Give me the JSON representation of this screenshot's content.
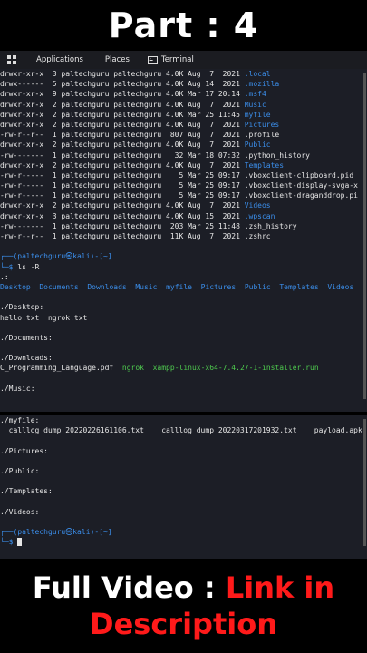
{
  "header": {
    "title": "Part : 4"
  },
  "panel": {
    "applications": "Applications",
    "places": "Places",
    "terminal": "Terminal"
  },
  "listing": [
    {
      "perm": "drwxr-xr-x",
      "links": "3",
      "user": "paltechguru",
      "group": "paltechguru",
      "size": "4.0K",
      "month": "Aug",
      "day": "7",
      "time": "2021",
      "name": ".local",
      "color": "blue"
    },
    {
      "perm": "drwx------",
      "links": "5",
      "user": "paltechguru",
      "group": "paltechguru",
      "size": "4.0K",
      "month": "Aug",
      "day": "14",
      "time": "2021",
      "name": ".mozilla",
      "color": "blue"
    },
    {
      "perm": "drwxr-xr-x",
      "links": "9",
      "user": "paltechguru",
      "group": "paltechguru",
      "size": "4.0K",
      "month": "Mar",
      "day": "17",
      "time": "20:14",
      "name": ".msf4",
      "color": "blue"
    },
    {
      "perm": "drwxr-xr-x",
      "links": "2",
      "user": "paltechguru",
      "group": "paltechguru",
      "size": "4.0K",
      "month": "Aug",
      "day": "7",
      "time": "2021",
      "name": "Music",
      "color": "blue"
    },
    {
      "perm": "drwxr-xr-x",
      "links": "2",
      "user": "paltechguru",
      "group": "paltechguru",
      "size": "4.0K",
      "month": "Mar",
      "day": "25",
      "time": "11:45",
      "name": "myfile",
      "color": "blue"
    },
    {
      "perm": "drwxr-xr-x",
      "links": "2",
      "user": "paltechguru",
      "group": "paltechguru",
      "size": "4.0K",
      "month": "Aug",
      "day": "7",
      "time": "2021",
      "name": "Pictures",
      "color": "blue"
    },
    {
      "perm": "-rw-r--r--",
      "links": "1",
      "user": "paltechguru",
      "group": "paltechguru",
      "size": "807",
      "month": "Aug",
      "day": "7",
      "time": "2021",
      "name": ".profile",
      "color": "white"
    },
    {
      "perm": "drwxr-xr-x",
      "links": "2",
      "user": "paltechguru",
      "group": "paltechguru",
      "size": "4.0K",
      "month": "Aug",
      "day": "7",
      "time": "2021",
      "name": "Public",
      "color": "blue"
    },
    {
      "perm": "-rw-------",
      "links": "1",
      "user": "paltechguru",
      "group": "paltechguru",
      "size": "32",
      "month": "Mar",
      "day": "18",
      "time": "07:32",
      "name": ".python_history",
      "color": "white"
    },
    {
      "perm": "drwxr-xr-x",
      "links": "2",
      "user": "paltechguru",
      "group": "paltechguru",
      "size": "4.0K",
      "month": "Aug",
      "day": "7",
      "time": "2021",
      "name": "Templates",
      "color": "blue"
    },
    {
      "perm": "-rw-r-----",
      "links": "1",
      "user": "paltechguru",
      "group": "paltechguru",
      "size": "5",
      "month": "Mar",
      "day": "25",
      "time": "09:17",
      "name": ".vboxclient-clipboard.pid",
      "color": "white"
    },
    {
      "perm": "-rw-r-----",
      "links": "1",
      "user": "paltechguru",
      "group": "paltechguru",
      "size": "5",
      "month": "Mar",
      "day": "25",
      "time": "09:17",
      "name": ".vboxclient-display-svga-x",
      "color": "white"
    },
    {
      "perm": "-rw-r-----",
      "links": "1",
      "user": "paltechguru",
      "group": "paltechguru",
      "size": "5",
      "month": "Mar",
      "day": "25",
      "time": "09:17",
      "name": ".vboxclient-draganddrop.pi",
      "color": "white"
    },
    {
      "perm": "drwxr-xr-x",
      "links": "2",
      "user": "paltechguru",
      "group": "paltechguru",
      "size": "4.0K",
      "month": "Aug",
      "day": "7",
      "time": "2021",
      "name": "Videos",
      "color": "blue"
    },
    {
      "perm": "drwxr-xr-x",
      "links": "3",
      "user": "paltechguru",
      "group": "paltechguru",
      "size": "4.0K",
      "month": "Aug",
      "day": "15",
      "time": "2021",
      "name": ".wpscan",
      "color": "blue"
    },
    {
      "perm": "-rw-------",
      "links": "1",
      "user": "paltechguru",
      "group": "paltechguru",
      "size": "203",
      "month": "Mar",
      "day": "25",
      "time": "11:48",
      "name": ".zsh_history",
      "color": "white"
    },
    {
      "perm": "-rw-r--r--",
      "links": "1",
      "user": "paltechguru",
      "group": "paltechguru",
      "size": "11K",
      "month": "Aug",
      "day": "7",
      "time": "2021",
      "name": ".zshrc",
      "color": "white"
    }
  ],
  "prompt": {
    "top": "┌──(paltechguru㉿kali)-[~]",
    "bottom_sym": "└─$",
    "command": "ls -R"
  },
  "recursive": {
    "root_header": ".:",
    "root_items": [
      "Desktop",
      "Documents",
      "Downloads",
      "Music",
      "myfile",
      "Pictures",
      "Public",
      "Templates",
      "Videos"
    ],
    "desktop_header": "./Desktop:",
    "desktop_items": "hello.txt  ngrok.txt",
    "documents_header": "./Documents:",
    "downloads_header": "./Downloads:",
    "downloads_file1": "C_Programming_Language.pdf",
    "downloads_file2": "ngrok",
    "downloads_file3": "xampp-linux-x64-7.4.27-1-installer.run",
    "music_header": "./Music:",
    "myfile_header": "./myfile:",
    "myfile_items": "  calllog_dump_20220226161106.txt    calllog_dump_20220317201932.txt    payload.apk",
    "pictures_header": "./Pictures:",
    "public_header": "./Public:",
    "templates_header": "./Templates:",
    "videos_header": "./Videos:"
  },
  "prompt2": {
    "top": "┌──(paltechguru㉿kali)-[~]",
    "bottom_sym": "└─$"
  },
  "footer": {
    "line1_white": "Full Video : ",
    "line1_red": "Link in",
    "line2_red": "Description"
  },
  "colors": {
    "dir": "#3b8eea",
    "exec": "#4ec94e",
    "accent_red": "#ff1a1a"
  }
}
